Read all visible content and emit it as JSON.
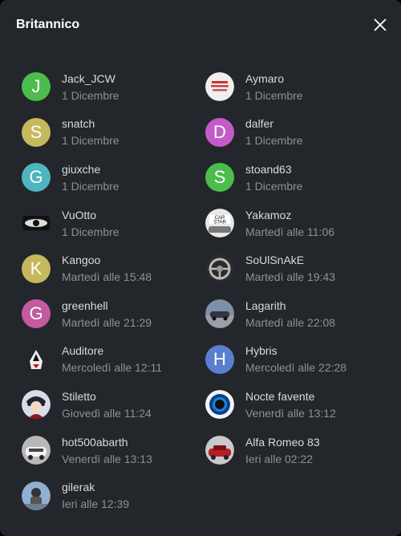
{
  "dialog": {
    "title": "Britannico",
    "close_icon": "close-icon"
  },
  "colors": {
    "background": "#23262b",
    "name_text": "#d9dadc",
    "time_text": "#8d9096",
    "green": "#4cbc4c",
    "olive": "#c6b85d",
    "teal": "#4fb6bf",
    "magenta": "#c35cc8",
    "pink": "#c45aa0",
    "blue": "#5b7fd0"
  },
  "users": [
    {
      "name": "Jack_JCW",
      "time": "1 Dicembre",
      "avatar": {
        "type": "letter",
        "letter": "J",
        "color": "#4cbc4c"
      }
    },
    {
      "name": "Aymaro",
      "time": "1 Dicembre",
      "avatar": {
        "type": "image",
        "icon": "text-logo-avatar-icon"
      }
    },
    {
      "name": "snatch",
      "time": "1 Dicembre",
      "avatar": {
        "type": "letter",
        "letter": "S",
        "color": "#c6b85d"
      }
    },
    {
      "name": "dalfer",
      "time": "1 Dicembre",
      "avatar": {
        "type": "letter",
        "letter": "D",
        "color": "#c35cc8"
      }
    },
    {
      "name": "giuxche",
      "time": "1 Dicembre",
      "avatar": {
        "type": "letter",
        "letter": "G",
        "color": "#4fb6bf"
      }
    },
    {
      "name": "stoand63",
      "time": "1 Dicembre",
      "avatar": {
        "type": "letter",
        "letter": "S",
        "color": "#4cbc4c"
      }
    },
    {
      "name": "VuOtto",
      "time": "1 Dicembre",
      "avatar": {
        "type": "image",
        "icon": "eye-avatar-icon"
      }
    },
    {
      "name": "Yakamoz",
      "time": "Martedì alle 11:06",
      "avatar": {
        "type": "image",
        "icon": "car-star-avatar-icon"
      }
    },
    {
      "name": "Kangoo",
      "time": "Martedì alle 15:48",
      "avatar": {
        "type": "letter",
        "letter": "K",
        "color": "#c6b85d"
      }
    },
    {
      "name": "SoUlSnAkE",
      "time": "Martedì alle 19:43",
      "avatar": {
        "type": "image",
        "icon": "steering-wheel-avatar-icon"
      }
    },
    {
      "name": "greenhell",
      "time": "Martedì alle 21:29",
      "avatar": {
        "type": "letter",
        "letter": "G",
        "color": "#c45aa0"
      }
    },
    {
      "name": "Lagarith",
      "time": "Martedì alle 22:08",
      "avatar": {
        "type": "image",
        "icon": "car-photo-avatar-icon"
      }
    },
    {
      "name": "Auditore",
      "time": "Mercoledì alle 12:11",
      "avatar": {
        "type": "image",
        "icon": "assassin-avatar-icon"
      }
    },
    {
      "name": "Hybris",
      "time": "Mercoledì alle 22:28",
      "avatar": {
        "type": "letter",
        "letter": "H",
        "color": "#5b7fd0"
      }
    },
    {
      "name": "Stiletto",
      "time": "Giovedì alle 11:24",
      "avatar": {
        "type": "image",
        "icon": "character-avatar-icon"
      }
    },
    {
      "name": "Nocte favente",
      "time": "Venerdì alle 13:12",
      "avatar": {
        "type": "image",
        "icon": "blue-ring-avatar-icon"
      }
    },
    {
      "name": "hot500abarth",
      "time": "Venerdì alle 13:13",
      "avatar": {
        "type": "image",
        "icon": "white-car-avatar-icon"
      }
    },
    {
      "name": "Alfa Romeo 83",
      "time": "Ieri alle 02:22",
      "avatar": {
        "type": "image",
        "icon": "red-car-avatar-icon"
      }
    },
    {
      "name": "gilerak",
      "time": "Ieri alle 12:39",
      "avatar": {
        "type": "image",
        "icon": "rider-avatar-icon"
      }
    }
  ]
}
